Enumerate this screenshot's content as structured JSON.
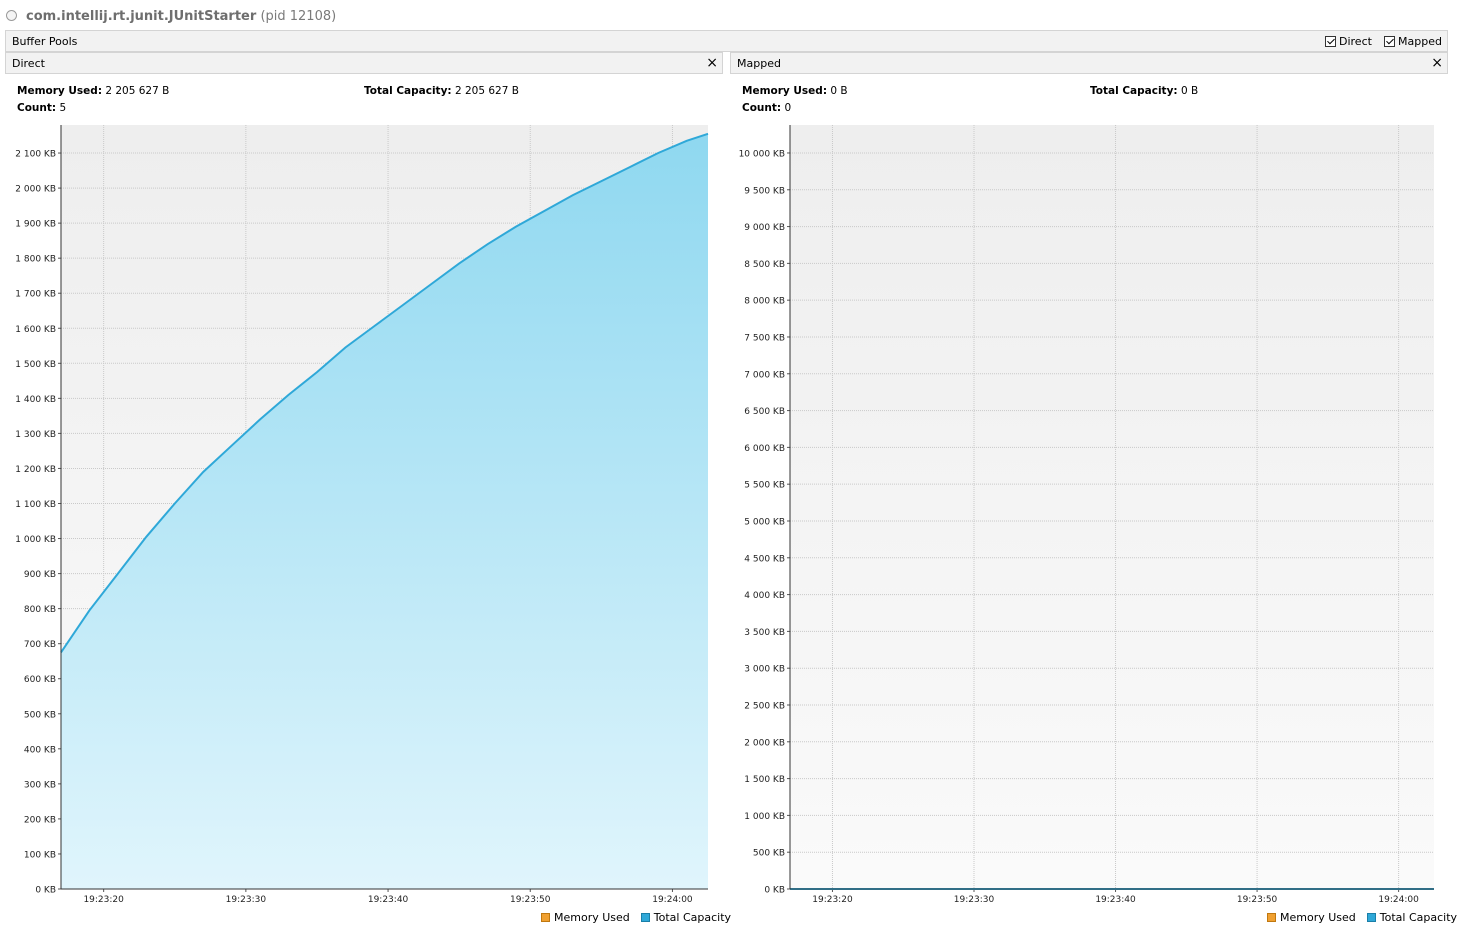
{
  "window": {
    "process_name": "com.intellij.rt.junit.JUnitStarter",
    "pid_label": "(pid 12108)"
  },
  "buffer_pools": {
    "title": "Buffer Pools",
    "checkboxes": [
      {
        "label": "Direct",
        "checked": true
      },
      {
        "label": "Mapped",
        "checked": true
      }
    ]
  },
  "colors": {
    "memory_used": "#f0a030",
    "total_capacity": "#2fa8d8",
    "fill_top": "#8fd8f0",
    "fill_bottom": "#e0f5fc",
    "plot_bg_top": "#eeeeee",
    "plot_bg_bottom": "#fafafa"
  },
  "panels": {
    "direct": {
      "name": "Direct",
      "memory_used_label": "Memory Used:",
      "memory_used_value": "2 205 627 B",
      "total_capacity_label": "Total Capacity:",
      "total_capacity_value": "2 205 627 B",
      "count_label": "Count:",
      "count_value": "5",
      "legend": [
        "Memory Used",
        "Total Capacity"
      ]
    },
    "mapped": {
      "name": "Mapped",
      "memory_used_label": "Memory Used:",
      "memory_used_value": "0 B",
      "total_capacity_label": "Total Capacity:",
      "total_capacity_value": "0 B",
      "count_label": "Count:",
      "count_value": "0",
      "legend": [
        "Memory Used",
        "Total Capacity"
      ]
    }
  },
  "chart_data": [
    {
      "type": "area",
      "title": "Direct",
      "x_ticks": [
        "19:23:20",
        "19:23:30",
        "19:23:40",
        "19:23:50",
        "19:24:00"
      ],
      "x_range_seconds_after_19_23_00": [
        17.0,
        62.5
      ],
      "x_tick_seconds": [
        20,
        30,
        40,
        50,
        60
      ],
      "y_ticks": [
        "0 KB",
        "100 KB",
        "200 KB",
        "300 KB",
        "400 KB",
        "500 KB",
        "600 KB",
        "700 KB",
        "800 KB",
        "900 KB",
        "1 000 KB",
        "1 100 KB",
        "1 200 KB",
        "1 300 KB",
        "1 400 KB",
        "1 500 KB",
        "1 600 KB",
        "1 700 KB",
        "1 800 KB",
        "1 900 KB",
        "2 000 KB",
        "2 100 KB"
      ],
      "ylim": [
        0,
        2180
      ],
      "y_unit": "KB",
      "grid": true,
      "legend_position": "bottom-right",
      "series": [
        {
          "name": "Total Capacity",
          "x": [
            17.0,
            19.0,
            21.0,
            23.0,
            25.0,
            27.0,
            29.0,
            31.0,
            33.0,
            35.0,
            37.0,
            39.0,
            41.0,
            43.0,
            45.0,
            47.0,
            49.0,
            51.0,
            53.0,
            55.0,
            57.0,
            59.0,
            61.0,
            62.5
          ],
          "values": [
            675,
            795,
            900,
            1005,
            1100,
            1190,
            1265,
            1340,
            1410,
            1475,
            1545,
            1605,
            1665,
            1725,
            1785,
            1840,
            1890,
            1935,
            1980,
            2020,
            2060,
            2100,
            2135,
            2155
          ]
        },
        {
          "name": "Memory Used",
          "x": [
            17.0,
            19.0,
            21.0,
            23.0,
            25.0,
            27.0,
            29.0,
            31.0,
            33.0,
            35.0,
            37.0,
            39.0,
            41.0,
            43.0,
            45.0,
            47.0,
            49.0,
            51.0,
            53.0,
            55.0,
            57.0,
            59.0,
            61.0,
            62.5
          ],
          "values": [
            675,
            795,
            900,
            1005,
            1100,
            1190,
            1265,
            1340,
            1410,
            1475,
            1545,
            1605,
            1665,
            1725,
            1785,
            1840,
            1890,
            1935,
            1980,
            2020,
            2060,
            2100,
            2135,
            2155
          ]
        }
      ]
    },
    {
      "type": "area",
      "title": "Mapped",
      "x_ticks": [
        "19:23:20",
        "19:23:30",
        "19:23:40",
        "19:23:50",
        "19:24:00"
      ],
      "x_range_seconds_after_19_23_00": [
        17.0,
        62.5
      ],
      "x_tick_seconds": [
        20,
        30,
        40,
        50,
        60
      ],
      "y_ticks": [
        "0 KB",
        "500 KB",
        "1 000 KB",
        "1 500 KB",
        "2 000 KB",
        "2 500 KB",
        "3 000 KB",
        "3 500 KB",
        "4 000 KB",
        "4 500 KB",
        "5 000 KB",
        "5 500 KB",
        "6 000 KB",
        "6 500 KB",
        "7 000 KB",
        "7 500 KB",
        "8 000 KB",
        "8 500 KB",
        "9 000 KB",
        "9 500 KB",
        "10 000 KB"
      ],
      "ylim": [
        0,
        10380
      ],
      "y_unit": "KB",
      "grid": true,
      "legend_position": "bottom-right",
      "series": [
        {
          "name": "Total Capacity",
          "x": [
            17.0,
            62.5
          ],
          "values": [
            0,
            0
          ]
        },
        {
          "name": "Memory Used",
          "x": [
            17.0,
            62.5
          ],
          "values": [
            0,
            0
          ]
        }
      ]
    }
  ]
}
